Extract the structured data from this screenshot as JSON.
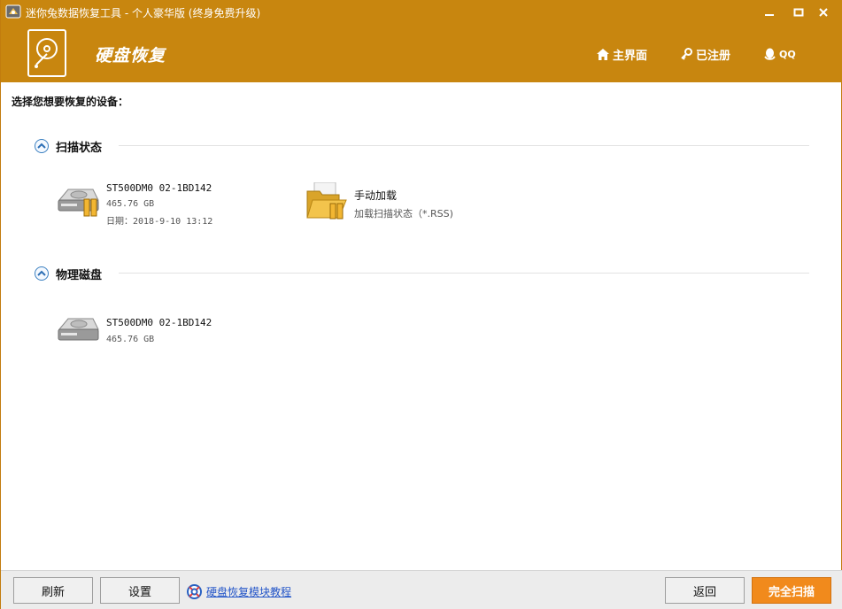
{
  "window": {
    "title": "迷你兔数据恢复工具 - 个人豪华版  (终身免费升级)"
  },
  "header": {
    "module_title": "硬盘恢复",
    "nav": {
      "home": "主界面",
      "registered": "已注册",
      "qq": "QQ"
    },
    "accent_color": "#c8860f"
  },
  "main": {
    "prompt": "选择您想要恢复的设备：",
    "sections": [
      {
        "title": "扫描状态",
        "items": [
          {
            "name": "ST500DM0 02-1BD142",
            "size": "465.76 GB",
            "date": "日期：2018-9-10 13:12",
            "icon": "hard-disk-scan-icon"
          },
          {
            "name": "手动加载",
            "desc": "加载扫描状态（*.RSS)",
            "icon": "folder-load-icon"
          }
        ]
      },
      {
        "title": "物理磁盘",
        "items": [
          {
            "name": "ST500DM0 02-1BD142",
            "size": "465.76 GB",
            "icon": "hard-disk-icon"
          }
        ]
      }
    ]
  },
  "footer": {
    "refresh": "刷新",
    "settings": "设置",
    "tutorial": "硬盘恢复模块教程",
    "back": "返回",
    "full_scan": "完全扫描",
    "full_scan_color": "#f18a1c"
  }
}
